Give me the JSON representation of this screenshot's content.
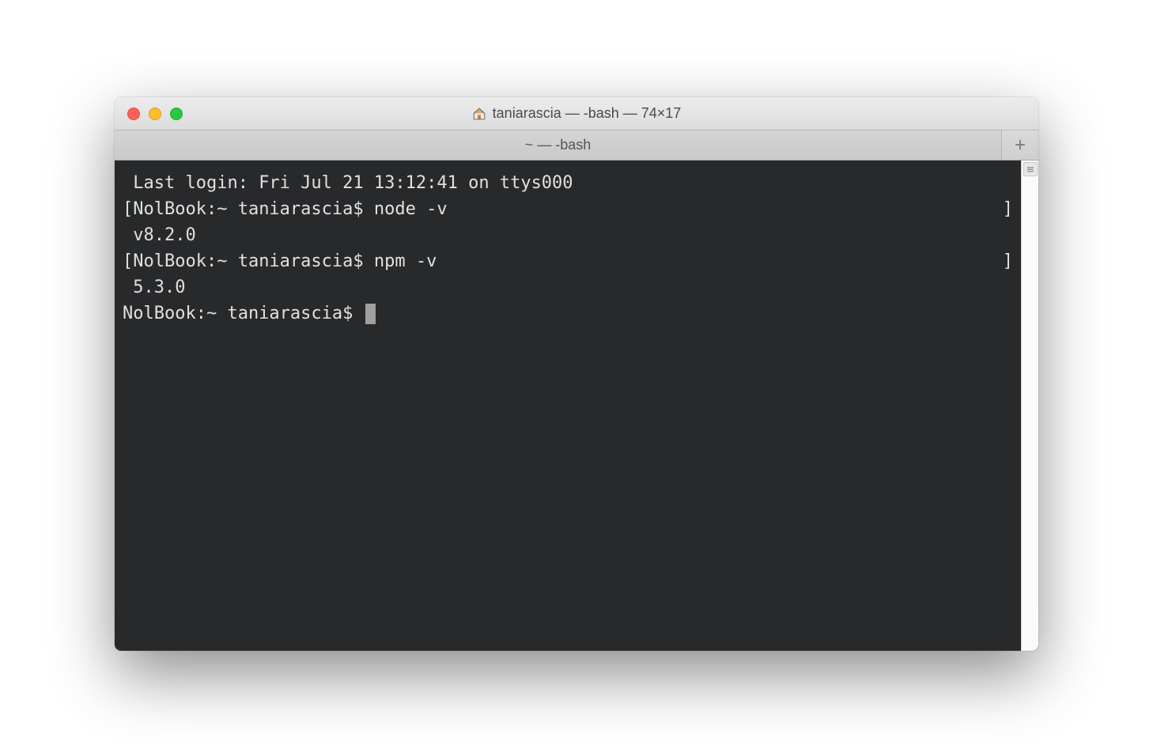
{
  "window": {
    "title": "taniarascia — -bash — 74×17"
  },
  "tabs": {
    "active": "~ — -bash"
  },
  "terminal": {
    "motd": "Last login: Fri Jul 21 13:12:41 on ttys000",
    "lines": [
      {
        "left_bracket": "[",
        "prompt": "NolBook:~ taniarascia$",
        "command": "node -v",
        "right_bracket": "]"
      },
      {
        "output": "v8.2.0"
      },
      {
        "left_bracket": "[",
        "prompt": "NolBook:~ taniarascia$",
        "command": "npm -v",
        "right_bracket": "]"
      },
      {
        "output": "5.3.0"
      }
    ],
    "current_prompt": "NolBook:~ taniarascia$ "
  }
}
